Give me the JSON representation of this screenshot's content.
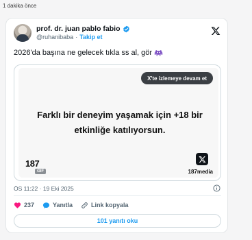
{
  "page": {
    "timestamp": "1 dakika önce"
  },
  "tweet": {
    "author": {
      "name": "prof. dr. juan pablo fabio",
      "handle": "@ruhanibaba",
      "follow_label": "Takip et",
      "verified": true
    },
    "text": "2026'da başına ne gelecek tıkla ss al, gör",
    "emoji_icon": "alien-monster-icon",
    "media": {
      "overlay_button": "X'te izlemeye devam et",
      "caption_line1": "Farklı bir deneyim yaşamak için +18 bir",
      "caption_line2": "etkinliğe katılıyorsun.",
      "brand_mark": "187",
      "gif_badge": "GIF",
      "brand_name": "187media"
    },
    "meta": "ÖS 11:22 · 19 Eki 2025",
    "actions": {
      "likes": "237",
      "reply_label": "Yanıtla",
      "copy_link_label": "Link kopyala"
    },
    "replies_button": "101 yanıtı oku"
  },
  "colors": {
    "accent": "#1d9bf0",
    "like": "#f91880",
    "text": "#0f1419",
    "muted": "#536471"
  }
}
